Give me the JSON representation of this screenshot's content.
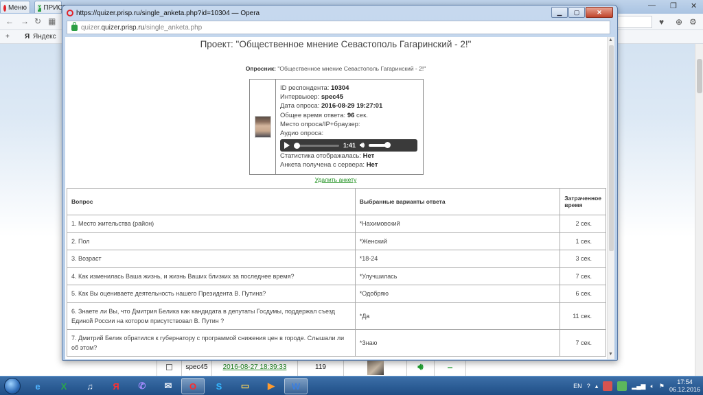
{
  "background": {
    "tab1_label": "Меню",
    "tab2_label": "ПРИСП",
    "bookmark_label": "Яндекс",
    "row": {
      "user": "spec45",
      "date": "2016-08-27 18:39:33",
      "count": "119",
      "dash": "–"
    }
  },
  "popup": {
    "title": "https://quizer.prisp.ru/single_anketa.php?id=10304 — Opera",
    "url_domain": "quizer.prisp.ru",
    "url_path": "/single_anketa.php",
    "url_prefix": "quizer."
  },
  "page": {
    "project_title": "Проект: \"Общественное мнение Севастополь Гагаринский - 2!\"",
    "questionnaire_label": "Опросник:",
    "questionnaire_value": "\"Общественное мнение Севастополь Гагаринский - 2!\"",
    "respondent": {
      "id_label": "ID респондента:",
      "id_value": "10304",
      "interviewer_label": "Интервьюер:",
      "interviewer_value": "spec45",
      "date_label": "Дата опроса:",
      "date_value": "2016-08-29 19:27:01",
      "total_time_label": "Общее время ответа:",
      "total_time_value": "96",
      "total_time_unit": "сек.",
      "place_label": "Место опроса/IP+браузер:",
      "audio_label": "Аудио опроса:",
      "audio_time": "1:41",
      "stats_label": "Статистика отображалась:",
      "stats_value": "Нет",
      "received_label": "Анкета получена с сервера:",
      "received_value": "Нет"
    },
    "delete_link": "Удалить анкету",
    "table": {
      "headers": [
        "Вопрос",
        "Выбранные варианты ответа",
        "Затраченное время"
      ],
      "rows": [
        {
          "q": "1. Место жительства (район)",
          "a": "*Нахимовский",
          "t": "2 сек."
        },
        {
          "q": "2. Пол",
          "a": "*Женский",
          "t": "1 сек."
        },
        {
          "q": "3. Возраст",
          "a": "*18-24",
          "t": "3 сек."
        },
        {
          "q": "4. Как изменилась Ваша жизнь, и жизнь Ваших близких за последнее время?",
          "a": "*Улучшилась",
          "t": "7 сек."
        },
        {
          "q": "5. Как Вы оцениваете деятельность нашего Президента В. Путина?",
          "a": "*Одобряю",
          "t": "6 сек."
        },
        {
          "q": "6. Знаете ли Вы, что Дмитрия Белика как кандидата в депутаты Госдумы, поддержал съезд Единой России на котором присутствовал В. Путин ?",
          "a": "*Да",
          "t": "11 сек."
        },
        {
          "q": "7. Дмитрий Белик обратился к губернатору с программой снижения цен в городе. Слышали ли об этом?",
          "a": "*Знаю",
          "t": "7 сек."
        }
      ]
    }
  },
  "taskbar": {
    "lang": "EN",
    "time": "17:54",
    "date": "06.12.2016"
  }
}
